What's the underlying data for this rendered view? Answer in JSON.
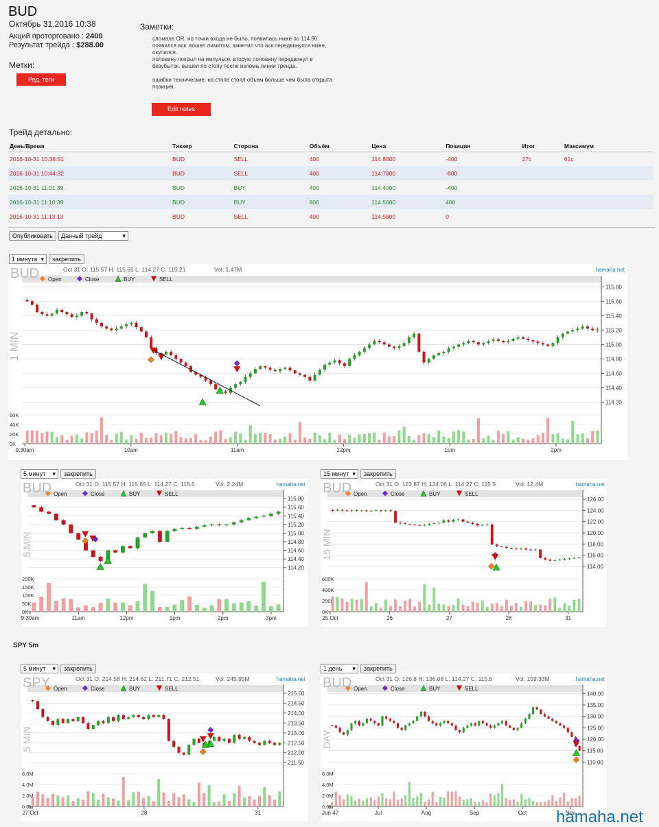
{
  "header": {
    "ticker": "BUD",
    "date": "Октябрь 31,2016 10:38",
    "shares_label": "Акций проторговано :",
    "shares_value": "2400",
    "result_label": "Результат трейда :",
    "result_value": "$288.00"
  },
  "tags": {
    "label": "Метки:",
    "button": "Ред. теги"
  },
  "notes": {
    "label": "Заметки:",
    "paragraphs": [
      "сломала OR. но точки входа не было, появилась ниже по 114.90. появился аск. вошел лимитом. заметил что аск передвинулся ниже, окупился.\nполовину покрыл на импульсе. вторую половину передвинул в безубыток. вышел по стопу после излома линии тренда.",
      "ошибки технические. на стопе стоял объем больше чем была открыта позиция."
    ],
    "button": "Edit notes"
  },
  "detail": {
    "title": "Трейд детально:",
    "columns": [
      "День/Время",
      "Тиккер",
      "Сторона",
      "Объём",
      "Цена",
      "Позиция",
      "Итог",
      "Максимум"
    ],
    "rows": [
      {
        "time": "2016-10-31 10:38:51",
        "ticker": "BUD",
        "side": "SELL",
        "volume": "400",
        "price": "114.8800",
        "position": "-400",
        "result": "27c",
        "max": "61c"
      },
      {
        "time": "2016-10-31 10:44:32",
        "ticker": "BUD",
        "side": "SELL",
        "volume": "400",
        "price": "114.7800",
        "position": "-800",
        "result": "",
        "max": ""
      },
      {
        "time": "2016-10-31 11:01:39",
        "ticker": "BUD",
        "side": "BUY",
        "volume": "400",
        "price": "114.4000",
        "position": "-400",
        "result": "",
        "max": ""
      },
      {
        "time": "2016-10-31 11:10:39",
        "ticker": "BUD",
        "side": "BUY",
        "volume": "800",
        "price": "114.5600",
        "position": "400",
        "result": "",
        "max": ""
      },
      {
        "time": "2016-10-31 11:13:13",
        "ticker": "BUD",
        "side": "SELL",
        "volume": "400",
        "price": "114.5800",
        "position": "0",
        "result": "",
        "max": ""
      }
    ]
  },
  "controls": {
    "publish": "Опубликовать",
    "trade_select": "Данный трейд",
    "pin": "закрепить"
  },
  "legend": {
    "open": "Open",
    "close": "Close",
    "buy": "BUY",
    "sell": "SELL"
  },
  "colors": {
    "up": "#2aa12a",
    "down": "#c8181e",
    "open_marker": "#f08020",
    "close_marker": "#6a2bc8",
    "buy_marker": "#22cc22",
    "sell_marker": "#cc1111",
    "link": "#1a7fd4"
  },
  "brand": "hamaha.net",
  "spy_title": "SPY 5m",
  "watermark": "hamaha.net",
  "chart_data": [
    {
      "id": "c1",
      "type": "candlestick",
      "symbol": "BUD",
      "interval": "1 минута",
      "side_label": "1 MIN",
      "info": "Oct 31 O: 115.57 H: 115.65 L: 114.27 C: 115.21",
      "vol": "Vol: 1.47M",
      "y_ticks": [
        "115.80",
        "115.60",
        "115.40",
        "115.20",
        "115.00",
        "114.80",
        "114.60",
        "114.40",
        "114.20"
      ],
      "ylim": [
        114.1,
        115.85
      ],
      "vol_ticks": [
        "60K",
        "40K",
        "20K",
        "0K"
      ],
      "x_ticks": [
        "9:30am",
        "10am",
        "11am",
        "12pm",
        "1pm",
        "2pm"
      ],
      "vol_max": 65000,
      "closes": [
        115.6,
        115.55,
        115.45,
        115.42,
        115.4,
        115.43,
        115.48,
        115.45,
        115.42,
        115.38,
        115.4,
        115.45,
        115.43,
        115.35,
        115.3,
        115.25,
        115.22,
        115.2,
        115.22,
        115.25,
        115.28,
        115.3,
        115.24,
        115.18,
        115.1,
        114.95,
        114.88,
        114.86,
        114.9,
        114.85,
        114.8,
        114.75,
        114.7,
        114.62,
        114.58,
        114.55,
        114.5,
        114.45,
        114.38,
        114.35,
        114.33,
        114.4,
        114.45,
        114.48,
        114.55,
        114.6,
        114.66,
        114.7,
        114.68,
        114.65,
        114.63,
        114.66,
        114.68,
        114.64,
        114.6,
        114.58,
        114.55,
        114.5,
        114.58,
        114.65,
        114.72,
        114.75,
        114.78,
        114.74,
        114.7,
        114.8,
        114.85,
        114.9,
        114.95,
        115.0,
        115.05,
        115.03,
        115.0,
        114.97,
        114.95,
        114.98,
        115.02,
        115.1,
        115.15,
        114.9,
        114.75,
        114.8,
        114.85,
        114.88,
        114.9,
        114.95,
        114.97,
        115.0,
        115.02,
        115.05,
        115.03,
        115.0,
        115.02,
        115.05,
        115.07,
        115.05,
        115.03,
        115.05,
        115.08,
        115.1,
        115.08,
        115.06,
        115.04,
        115.02,
        115.0,
        114.98,
        115.02,
        115.1,
        115.15,
        115.18,
        115.2,
        115.22,
        115.25,
        115.22,
        115.2,
        115.21
      ],
      "markers": [
        {
          "t": 0.22,
          "kind": "open",
          "price": 114.79
        },
        {
          "t": 0.224,
          "kind": "sell",
          "price": 114.92
        },
        {
          "t": 0.238,
          "kind": "sell",
          "price": 114.83
        },
        {
          "t": 0.31,
          "kind": "buy",
          "price": 114.2
        },
        {
          "t": 0.34,
          "kind": "buy",
          "price": 114.36
        },
        {
          "t": 0.37,
          "kind": "close",
          "price": 114.74
        },
        {
          "t": 0.37,
          "kind": "sell",
          "price": 114.66
        }
      ]
    },
    {
      "id": "c2",
      "type": "candlestick",
      "symbol": "BUD",
      "interval": "5 минут",
      "side_label": "5 MIN",
      "info": "Oct 31 O: 115.57 H: 115.65 L: 114.27 C: 115.5",
      "vol": "Vol: 2.24M",
      "y_ticks": [
        "115.80",
        "115.60",
        "115.40",
        "115.20",
        "115.00",
        "114.80",
        "114.60",
        "114.40",
        "114.20"
      ],
      "ylim": [
        114.1,
        115.85
      ],
      "vol_ticks": [
        "200K",
        "150K",
        "100K",
        "50K",
        "0K"
      ],
      "x_ticks": [
        "9:30am",
        "11am",
        "12pm",
        "1pm",
        "2pm",
        "3pm"
      ],
      "vol_max": 210000,
      "closes": [
        115.6,
        115.5,
        115.45,
        115.3,
        115.2,
        115.0,
        114.85,
        114.6,
        114.45,
        114.35,
        114.6,
        114.55,
        114.7,
        114.65,
        114.9,
        115.0,
        115.05,
        114.8,
        115.05,
        115.1,
        115.12,
        115.1,
        115.15,
        115.18,
        115.2,
        115.18,
        115.2,
        115.25,
        115.3,
        115.35,
        115.38,
        115.4,
        115.45,
        115.5
      ],
      "markers": [
        {
          "t": 0.22,
          "kind": "open",
          "price": 114.82
        },
        {
          "t": 0.22,
          "kind": "sell",
          "price": 114.98
        },
        {
          "t": 0.25,
          "kind": "sell",
          "price": 114.88
        },
        {
          "t": 0.26,
          "kind": "close",
          "price": 114.86
        },
        {
          "t": 0.28,
          "kind": "buy",
          "price": 114.22
        },
        {
          "t": 0.31,
          "kind": "buy",
          "price": 114.36
        }
      ]
    },
    {
      "id": "c3",
      "type": "candlestick",
      "symbol": "BUD",
      "interval": "15 минут",
      "side_label": "15 MIN",
      "info": "Oct 31 O: 123.87 H: 124.06 L: 114.27 C: 115.5",
      "vol": "Vol: 12.4M",
      "y_ticks": [
        "126.00",
        "124.00",
        "122.00",
        "120.00",
        "118.00",
        "116.00",
        "114.00"
      ],
      "ylim": [
        113,
        126.5
      ],
      "vol_ticks": [
        "600K",
        "400K",
        "200K",
        "0K"
      ],
      "x_ticks": [
        "25 Oct",
        "26",
        "27",
        "28",
        "31"
      ],
      "vol_max": 650000,
      "closes": [
        124,
        124.1,
        124.0,
        123.9,
        124.0,
        123.95,
        124.0,
        123.9,
        123.95,
        124.0,
        123.9,
        124.0,
        123.9,
        121.8,
        121.7,
        121.6,
        121.5,
        121.4,
        121.3,
        121.4,
        121.6,
        121.7,
        121.8,
        122.2,
        122.0,
        122.3,
        122.4,
        122.0,
        121.8,
        121.6,
        121.3,
        121.4,
        121.5,
        117.9,
        117.6,
        117.5,
        117.3,
        117.2,
        117.1,
        117.2,
        117.0,
        116.9,
        117.0,
        115.5,
        115.2,
        115.0,
        115.1,
        115.2,
        115.3,
        115.4,
        115.5,
        115.6
      ],
      "markers": [
        {
          "t": 0.66,
          "kind": "close",
          "price": 116.0
        },
        {
          "t": 0.66,
          "kind": "sell",
          "price": 115.7
        },
        {
          "t": 0.645,
          "kind": "open",
          "price": 114.0
        },
        {
          "t": 0.665,
          "kind": "buy",
          "price": 113.8
        }
      ]
    },
    {
      "id": "c4",
      "type": "candlestick",
      "symbol": "SPY",
      "interval": "5 минут",
      "side_label": "5 MIN",
      "info": "Oct 31 O: 214.58 H: 214.62 L: 211.71 C: 212.51",
      "vol": "Vol: 245.95M",
      "y_ticks": [
        "215.00",
        "214.50",
        "214.00",
        "213.50",
        "213.00",
        "212.50",
        "212.00",
        "211.50"
      ],
      "ylim": [
        211.3,
        215.1
      ],
      "vol_ticks": [
        "6.0M",
        "4.0M",
        "2.0M",
        "0.0M"
      ],
      "x_ticks": [
        "27 Oct",
        "28",
        "31"
      ],
      "vol_max": 6500000,
      "closes": [
        214.6,
        214.2,
        213.8,
        213.6,
        213.4,
        213.7,
        213.5,
        213.7,
        213.6,
        213.8,
        213.5,
        213.2,
        213.4,
        213.6,
        213.5,
        213.8,
        213.6,
        213.9,
        213.7,
        213.8,
        213.9,
        213.8,
        213.7,
        213.9,
        213.8,
        213.9,
        213.7,
        212.6,
        212.3,
        212.0,
        211.9,
        212.4,
        212.7,
        212.5,
        212.3,
        212.6,
        212.8,
        212.6,
        212.7,
        212.5,
        212.9,
        212.7,
        212.8,
        212.6,
        212.5,
        212.4,
        212.6,
        212.5,
        212.4,
        212.5
      ],
      "markers": [
        {
          "t": 0.69,
          "kind": "sell",
          "price": 212.7
        },
        {
          "t": 0.69,
          "kind": "open",
          "price": 212.05
        },
        {
          "t": 0.7,
          "kind": "buy",
          "price": 212.4
        },
        {
          "t": 0.72,
          "kind": "close",
          "price": 213.15
        },
        {
          "t": 0.72,
          "kind": "sell",
          "price": 212.85
        },
        {
          "t": 0.72,
          "kind": "buy",
          "price": 212.45
        }
      ]
    },
    {
      "id": "c5",
      "type": "candlestick",
      "symbol": "BUD",
      "interval": "1 день",
      "side_label": "DAY",
      "info": "Oct 31 O: 126.8 H: 136.08 L: 114.27 C: 115.5",
      "vol": "Vol: 159.33M",
      "y_ticks": [
        "140.00",
        "135.00",
        "130.00",
        "125.00",
        "120.00",
        "115.00",
        "110.00"
      ],
      "ylim": [
        108,
        141
      ],
      "vol_ticks": [
        "6.0M",
        "4.0M",
        "2.0M",
        "0.0M"
      ],
      "x_ticks": [
        "Jun 47",
        "Jul",
        "Aug",
        "Sep",
        "Oct",
        "Nov"
      ],
      "vol_max": 6500000,
      "closes": [
        126,
        125,
        123,
        122,
        124,
        127,
        128,
        126,
        127,
        129,
        128,
        127,
        126,
        130,
        129,
        128,
        127,
        125,
        124,
        126,
        127,
        128,
        130,
        132,
        130,
        128,
        127,
        126,
        127,
        128,
        127,
        126,
        124,
        123,
        125,
        126,
        127,
        126,
        128,
        127,
        126,
        125,
        126,
        127,
        128,
        126,
        125,
        124,
        125,
        127,
        129,
        131,
        134,
        133,
        131,
        130,
        129,
        128,
        127,
        126,
        125,
        123,
        121,
        117,
        115
      ],
      "markers": [
        {
          "t": 0.985,
          "kind": "close",
          "price": 119.5
        },
        {
          "t": 0.985,
          "kind": "sell",
          "price": 118.0
        },
        {
          "t": 0.985,
          "kind": "buy",
          "price": 114.0
        },
        {
          "t": 0.985,
          "kind": "open",
          "price": 111.0
        }
      ]
    }
  ]
}
